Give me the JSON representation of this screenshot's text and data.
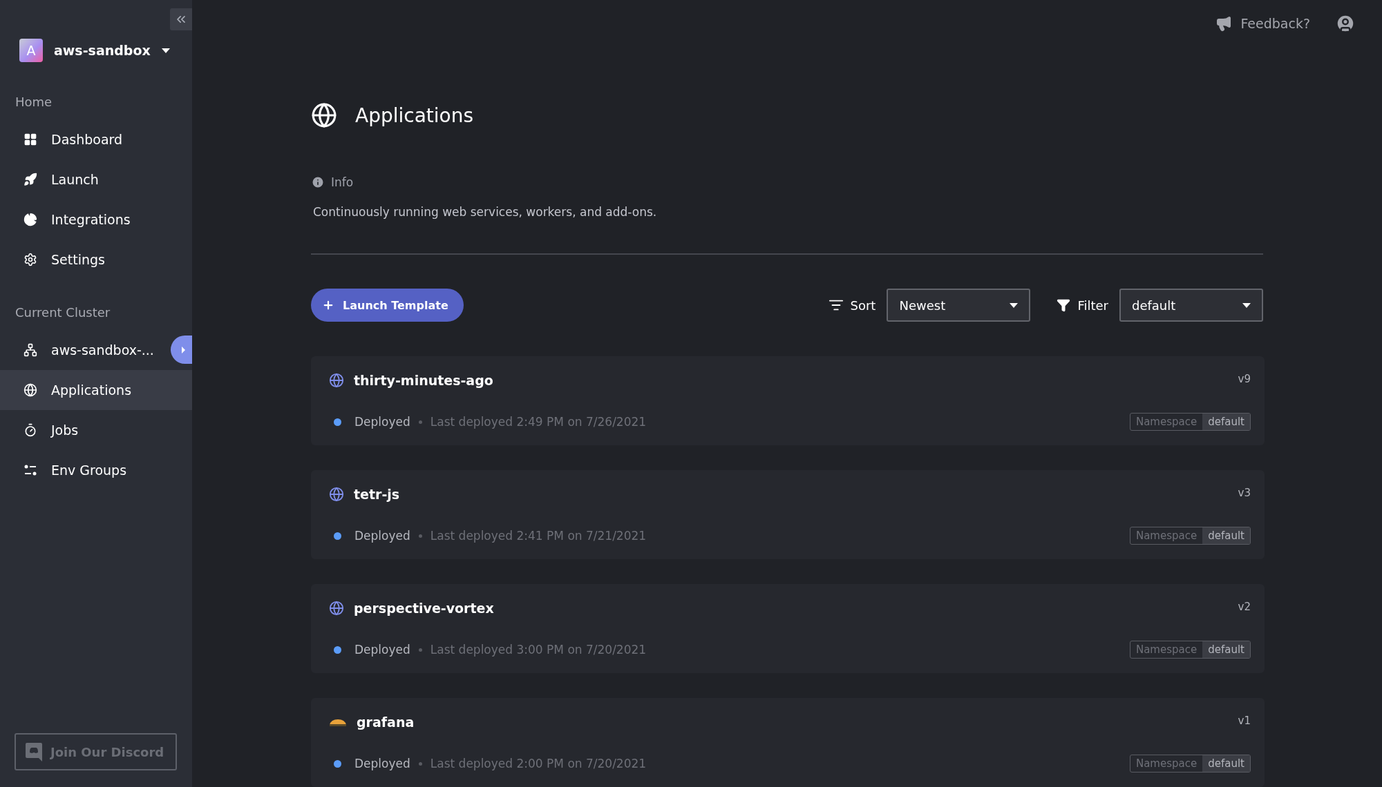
{
  "sidebar": {
    "workspace": {
      "avatar": "A",
      "name": "aws-sandbox"
    },
    "sections": [
      {
        "title": "Home",
        "items": [
          {
            "label": "Dashboard",
            "kind": "dashboard",
            "selected": false,
            "expand_button": false
          },
          {
            "label": "Launch",
            "kind": "launch",
            "selected": false,
            "expand_button": false
          },
          {
            "label": "Integrations",
            "kind": "integrations",
            "selected": false,
            "expand_button": false
          },
          {
            "label": "Settings",
            "kind": "settings",
            "selected": false,
            "expand_button": false
          }
        ]
      },
      {
        "title": "Current Cluster",
        "items": [
          {
            "label": "aws-sandbox-...",
            "kind": "cluster",
            "selected": false,
            "expand_button": true
          },
          {
            "label": "Applications",
            "kind": "globe",
            "selected": true,
            "expand_button": false
          },
          {
            "label": "Jobs",
            "kind": "timer",
            "selected": false,
            "expand_button": false
          },
          {
            "label": "Env Groups",
            "kind": "env",
            "selected": false,
            "expand_button": false
          }
        ]
      }
    ],
    "discord_button": "Join Our Discord"
  },
  "topbar": {
    "feedback": "Feedback?"
  },
  "page": {
    "title": "Applications",
    "info_label": "Info",
    "description": "Continuously running web services, workers, and add-ons.",
    "launch_button": "Launch Template",
    "sort": {
      "label": "Sort",
      "value": "Newest"
    },
    "filter": {
      "label": "Filter",
      "value": "default"
    }
  },
  "apps": [
    {
      "name": "thirty-minutes-ago",
      "kind": "globe",
      "status": "Deployed",
      "last_deployed": "Last deployed 2:49 PM on 7/26/2021",
      "version": "v9",
      "namespace_label": "Namespace",
      "namespace": "default"
    },
    {
      "name": "tetr-js",
      "kind": "globe",
      "status": "Deployed",
      "last_deployed": "Last deployed 2:41 PM on 7/21/2021",
      "version": "v3",
      "namespace_label": "Namespace",
      "namespace": "default"
    },
    {
      "name": "perspective-vortex",
      "kind": "globe",
      "status": "Deployed",
      "last_deployed": "Last deployed 3:00 PM on 7/20/2021",
      "version": "v2",
      "namespace_label": "Namespace",
      "namespace": "default"
    },
    {
      "name": "grafana",
      "kind": "grafana",
      "status": "Deployed",
      "last_deployed": "Last deployed 2:00 PM on 7/20/2021",
      "version": "v1",
      "namespace_label": "Namespace",
      "namespace": "default"
    }
  ]
}
